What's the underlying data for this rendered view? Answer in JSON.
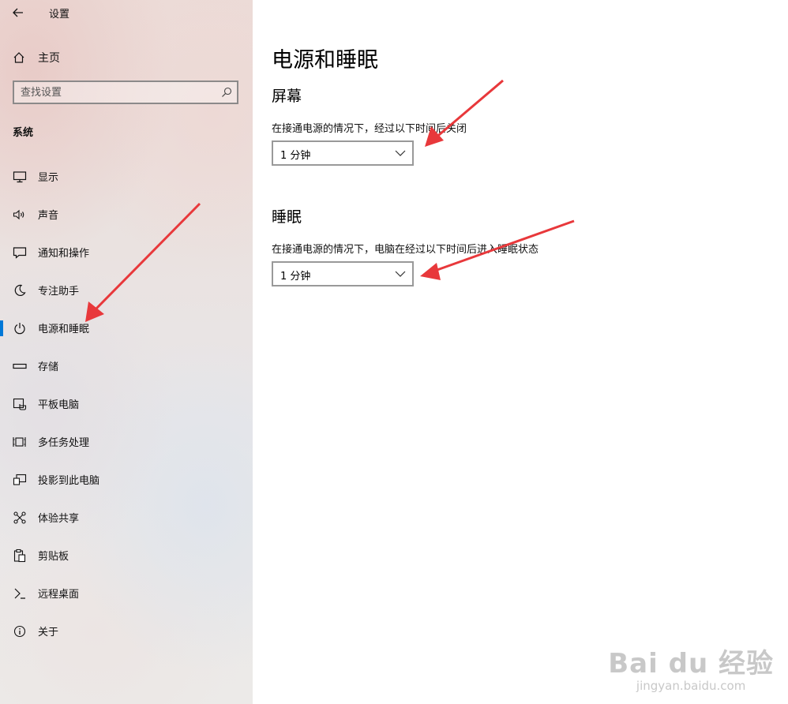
{
  "app": {
    "title": "设置"
  },
  "sidebar": {
    "home_label": "主页",
    "search_placeholder": "查找设置",
    "section_label": "系统",
    "items": [
      {
        "label": "显示",
        "icon": "monitor-icon"
      },
      {
        "label": "声音",
        "icon": "speaker-icon"
      },
      {
        "label": "通知和操作",
        "icon": "notification-icon"
      },
      {
        "label": "专注助手",
        "icon": "moon-icon"
      },
      {
        "label": "电源和睡眠",
        "icon": "power-icon",
        "active": true
      },
      {
        "label": "存储",
        "icon": "storage-icon"
      },
      {
        "label": "平板电脑",
        "icon": "tablet-icon"
      },
      {
        "label": "多任务处理",
        "icon": "multitasking-icon"
      },
      {
        "label": "投影到此电脑",
        "icon": "projection-icon"
      },
      {
        "label": "体验共享",
        "icon": "share-icon"
      },
      {
        "label": "剪贴板",
        "icon": "clipboard-icon"
      },
      {
        "label": "远程桌面",
        "icon": "remote-desktop-icon"
      },
      {
        "label": "关于",
        "icon": "info-icon"
      }
    ]
  },
  "main": {
    "title": "电源和睡眠",
    "screen": {
      "heading": "屏幕",
      "label": "在接通电源的情况下，经过以下时间后关闭",
      "value": "1 分钟"
    },
    "sleep": {
      "heading": "睡眠",
      "label": "在接通电源的情况下，电脑在经过以下时间后进入睡眠状态",
      "value": "1 分钟"
    }
  },
  "watermark": {
    "main": "Bai du 经验",
    "sub": "jingyan.baidu.com"
  },
  "colors": {
    "accent": "#0078d7",
    "annotation_arrow": "#e8383b"
  }
}
